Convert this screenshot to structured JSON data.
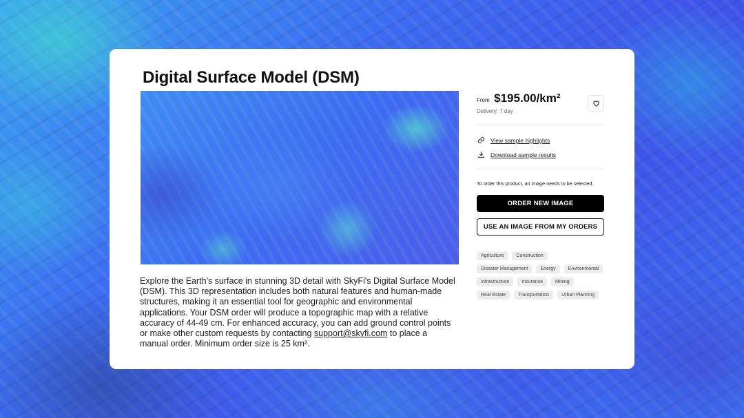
{
  "product": {
    "title": "Digital Surface Model (DSM)",
    "description_main": "Explore the Earth's surface in stunning 3D detail with SkyFi's Digital Surface Model (DSM). This 3D representation includes both natural features and human-made structures, making it an essential tool for geographic and environmental applications. Your DSM order will produce a topographic map with a relative accuracy of 44-49 cm. For enhanced accuracy, you can add ground control points or make other custom requests by contacting ",
    "support_email": "support@skyfi.com",
    "description_end": " to place a manual order. Minimum order size is 25 km²."
  },
  "pricing": {
    "from_label": "From",
    "price": "$195.00/km²",
    "delivery": "Delivery: 7 day"
  },
  "links": {
    "view_sample": "View sample highlights",
    "download_sample": "Download sample results"
  },
  "order": {
    "note": "To order this product, an image needs to be selected.",
    "order_new_label": "ORDER NEW IMAGE",
    "use_existing_label": "USE AN IMAGE FROM MY ORDERS"
  },
  "tags": [
    "Agriculture",
    "Construction",
    "Disaster Management",
    "Energy",
    "Environmental",
    "Infrastructure",
    "Insurance",
    "Mining",
    "Real Estate",
    "Transportation",
    "Urban Planning"
  ],
  "icons": {
    "favorite": "heart-icon",
    "view": "link-icon",
    "download": "download-icon"
  }
}
